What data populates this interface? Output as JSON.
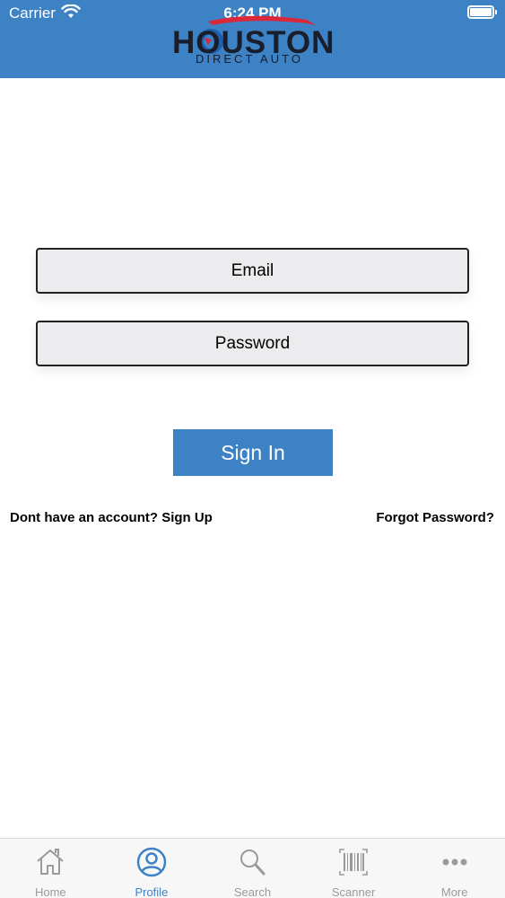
{
  "status_bar": {
    "carrier": "Carrier",
    "time": "6:24 PM",
    "battery_level": 1.0
  },
  "header": {
    "logo_text": "HOUSTON",
    "logo_subtext": "DIRECT AUTO",
    "background_color": "#3d82c5"
  },
  "form": {
    "email_placeholder": "Email",
    "password_placeholder": "Password",
    "sign_in_label": "Sign In",
    "signup_link": "Dont have an account? Sign Up",
    "forgot_link": "Forgot Password?"
  },
  "tabbar": {
    "active_color": "#3d82c5",
    "inactive_color": "#9a9a9a",
    "items": [
      {
        "label": "Home",
        "icon": "home-icon",
        "active": false
      },
      {
        "label": "Profile",
        "icon": "profile-icon",
        "active": true
      },
      {
        "label": "Search",
        "icon": "search-icon",
        "active": false
      },
      {
        "label": "Scanner",
        "icon": "barcode-icon",
        "active": false
      },
      {
        "label": "More",
        "icon": "more-icon",
        "active": false
      }
    ]
  }
}
